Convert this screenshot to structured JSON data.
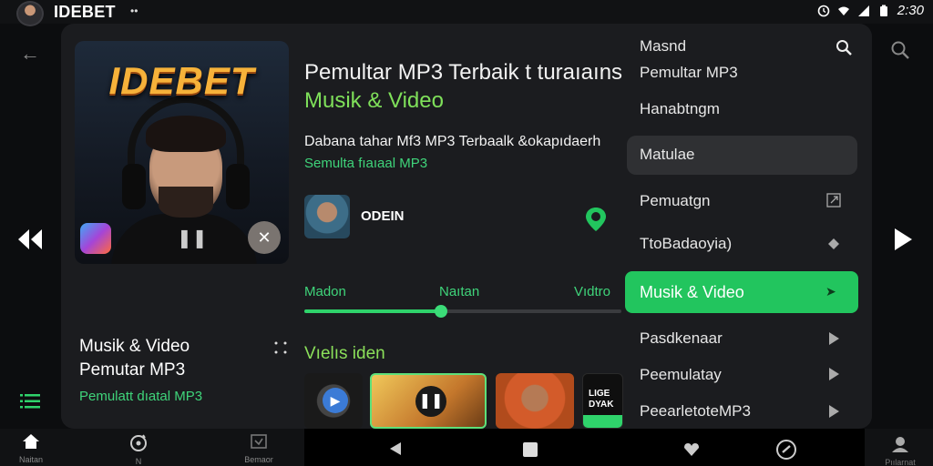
{
  "status_bar": {
    "title": "IDEBET",
    "dots": "••",
    "time": "2:30"
  },
  "cover": {
    "title": "IDEBET"
  },
  "header": {
    "title": "Pemultar MP3 Terbaik t turaıaıns",
    "subtitle": "Musik & Video",
    "description": "Dabana tahar Mf3 MP3 Terbaalk &okapıdaerh",
    "description_sub": "Semulta fıaıaal MP3"
  },
  "artist": {
    "name": "ODEIN"
  },
  "tabs": [
    "Madon",
    "Naıtan",
    "Vıdtro"
  ],
  "progress": {
    "value": 0.43
  },
  "section": {
    "title": "Vıelıs iden"
  },
  "thumb_text": "LIGE DYAK",
  "now_playing": {
    "title": "Musik & Video",
    "subtitle": "Pemutar MP3",
    "small": "Pemulatt dıatal MP3"
  },
  "menu": {
    "items": [
      {
        "label": "Masnd"
      },
      {
        "label": "Pemultar MP3"
      },
      {
        "label": "Hanabtngm"
      },
      {
        "label": "Matulae"
      },
      {
        "label": "Pemuatgn"
      },
      {
        "label": "TtoBadaoyia)"
      },
      {
        "label": "Musik & Video"
      },
      {
        "label": "Pasdkenaar"
      },
      {
        "label": "Peemulatay"
      },
      {
        "label": "PeearletoteMP3"
      }
    ]
  },
  "bottom_nav": {
    "home": "Naitan",
    "second": "N",
    "third": "Bemaor",
    "profile": "Pıılarnat"
  },
  "colors": {
    "accent": "#22c55e",
    "card": "#1b1c1f",
    "background": "#0c0d0f",
    "cover_title": "#f6b23a"
  }
}
